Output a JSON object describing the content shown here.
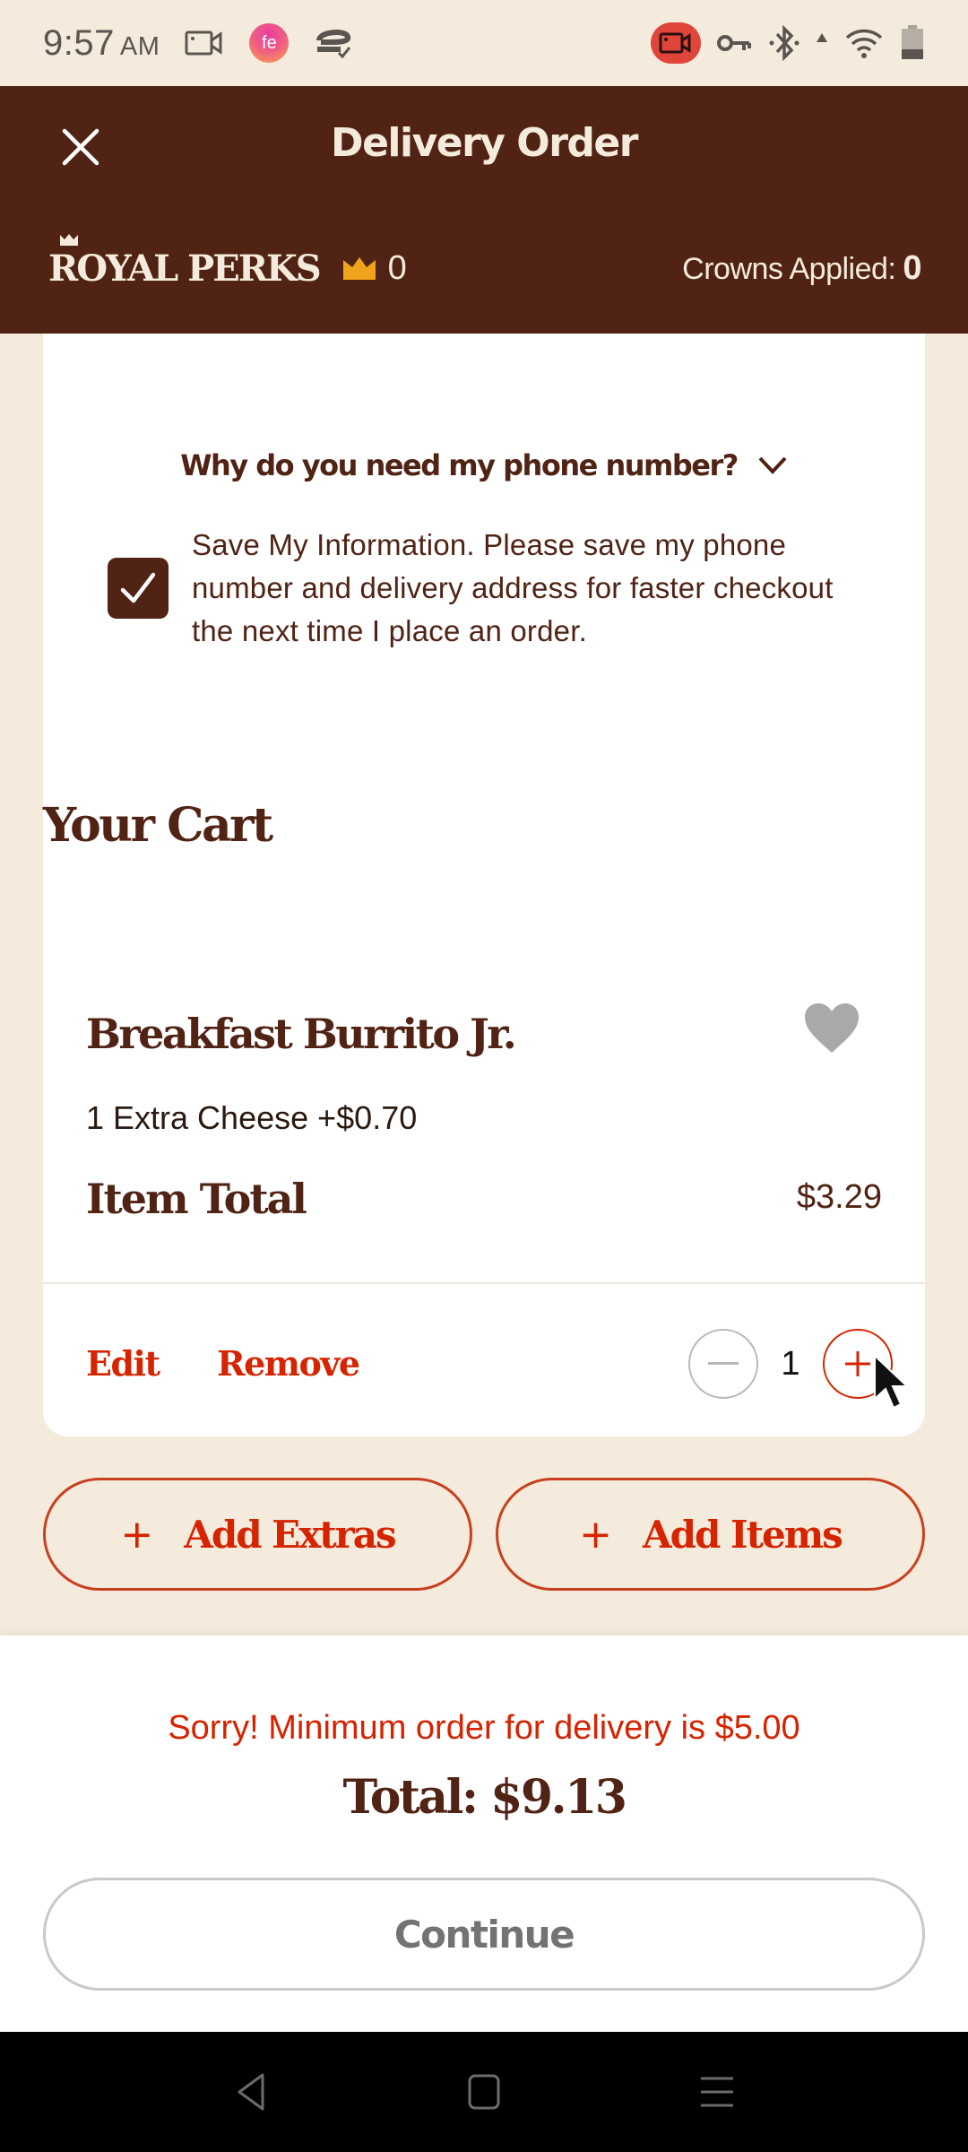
{
  "status_bar": {
    "time": "9:57",
    "ampm": "AM",
    "left_icons": [
      "screen-record-icon",
      "app-notification-icon",
      "sync-icon"
    ],
    "right_icons": [
      "recording-indicator-icon",
      "vpn-key-icon",
      "bluetooth-icon",
      "signal-icon",
      "wifi-icon",
      "battery-icon"
    ]
  },
  "header": {
    "title": "Delivery Order",
    "close_icon": "close-icon",
    "rewards": {
      "brand": "ROYAL PERKS",
      "crown_balance": "0",
      "crowns_applied_label": "Crowns Applied:",
      "crowns_applied_value": "0"
    }
  },
  "contact_card": {
    "phone_help_label": "Why do you need my phone number?",
    "save_info": {
      "checked": true,
      "text": "Save My Information. Please save my phone number and delivery address for faster checkout the next time I place an order."
    }
  },
  "cart": {
    "title": "Your Cart",
    "items": [
      {
        "name": "Breakfast Burrito Jr.",
        "favorite": false,
        "modifiers": [
          "1 Extra Cheese +$0.70"
        ],
        "item_total_label": "Item Total",
        "item_total": "$3.29",
        "edit_label": "Edit",
        "remove_label": "Remove",
        "quantity": "1"
      }
    ],
    "add_extras_label": "Add Extras",
    "add_items_label": "Add Items"
  },
  "summary": {
    "minimum_warning": "Sorry! Minimum order for delivery is $5.00",
    "total": "Total: $9.13",
    "continue_label": "Continue"
  },
  "colors": {
    "brand_brown": "#502314",
    "accent_red": "#d62300",
    "background": "#f5ebdd",
    "crown_gold": "#f0a41b"
  }
}
